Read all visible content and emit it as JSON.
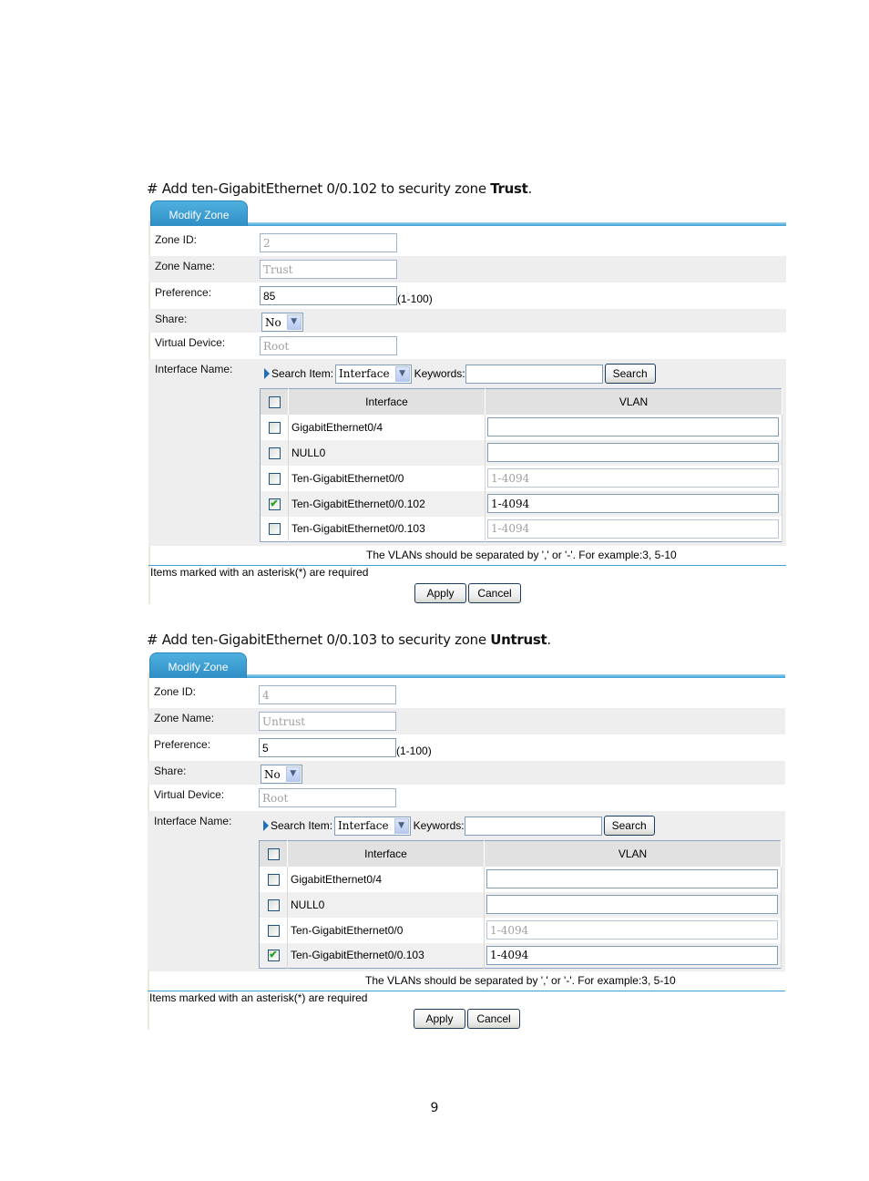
{
  "sections": [
    {
      "caption": {
        "prefix": "# Add ten-GigabitEthernet 0/0.102 to security zone ",
        "zone": "Trust",
        "suffix": "."
      },
      "tab_label": "Modify Zone",
      "fields": {
        "zone_id": {
          "label": "Zone ID:",
          "value": "2"
        },
        "zone_name": {
          "label": "Zone Name:",
          "value": "Trust"
        },
        "preference": {
          "label": "Preference:",
          "value": "85",
          "hint": "(1-100)"
        },
        "share": {
          "label": "Share:",
          "value": "No"
        },
        "virtual_device": {
          "label": "Virtual Device:",
          "value": "Root"
        },
        "interface_name": {
          "label": "Interface Name:"
        }
      },
      "search": {
        "search_item_label": "Search Item:",
        "search_item_value": "Interface",
        "keywords_label": "Keywords:",
        "keywords_value": "",
        "button": "Search"
      },
      "table": {
        "headers": {
          "interface": "Interface",
          "vlan": "VLAN"
        },
        "rows": [
          {
            "interface": "GigabitEthernet0/4",
            "checked": false,
            "vlan": "",
            "vlan_disabled": false
          },
          {
            "interface": "NULL0",
            "checked": false,
            "vlan": "",
            "vlan_disabled": false
          },
          {
            "interface": "Ten-GigabitEthernet0/0",
            "checked": false,
            "vlan": "1-4094",
            "vlan_disabled": true
          },
          {
            "interface": "Ten-GigabitEthernet0/0.102",
            "checked": true,
            "vlan": "1-4094",
            "vlan_disabled": false
          },
          {
            "interface": "Ten-GigabitEthernet0/0.103",
            "checked": false,
            "vlan": "1-4094",
            "vlan_disabled": true
          }
        ]
      },
      "vlan_note": "The VLANs should be separated by ',' or '-'. For example:3, 5-10",
      "required_note": "Items marked with an asterisk(*) are required",
      "apply": "Apply",
      "cancel": "Cancel"
    },
    {
      "caption": {
        "prefix": "# Add ten-GigabitEthernet 0/0.103 to security zone ",
        "zone": "Untrust",
        "suffix": "."
      },
      "tab_label": "Modify Zone",
      "fields": {
        "zone_id": {
          "label": "Zone ID:",
          "value": "4"
        },
        "zone_name": {
          "label": "Zone Name:",
          "value": "Untrust"
        },
        "preference": {
          "label": "Preference:",
          "value": "5",
          "hint": "(1-100)"
        },
        "share": {
          "label": "Share:",
          "value": "No"
        },
        "virtual_device": {
          "label": "Virtual Device:",
          "value": "Root"
        },
        "interface_name": {
          "label": "Interface Name:"
        }
      },
      "search": {
        "search_item_label": "Search Item:",
        "search_item_value": "Interface",
        "keywords_label": "Keywords:",
        "keywords_value": "",
        "button": "Search"
      },
      "table": {
        "headers": {
          "interface": "Interface",
          "vlan": "VLAN"
        },
        "rows": [
          {
            "interface": "GigabitEthernet0/4",
            "checked": false,
            "vlan": "",
            "vlan_disabled": false
          },
          {
            "interface": "NULL0",
            "checked": false,
            "vlan": "",
            "vlan_disabled": false
          },
          {
            "interface": "Ten-GigabitEthernet0/0",
            "checked": false,
            "vlan": "1-4094",
            "vlan_disabled": true
          },
          {
            "interface": "Ten-GigabitEthernet0/0.103",
            "checked": true,
            "vlan": "1-4094",
            "vlan_disabled": false
          }
        ]
      },
      "vlan_note": "The VLANs should be separated by ',' or '-'. For example:3, 5-10",
      "required_note": "Items marked with an asterisk(*) are required",
      "apply": "Apply",
      "cancel": "Cancel"
    }
  ],
  "page_number": "9",
  "colors": {
    "tab_blue": "#2f8fc6",
    "check_green": "#21a121",
    "disabled_text": "#a0a0a0"
  }
}
